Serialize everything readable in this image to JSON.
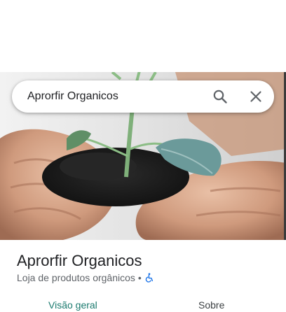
{
  "search": {
    "value": "Aprorfir Organicos",
    "search_icon": "search-icon",
    "close_icon": "close-icon"
  },
  "hero": {
    "image_subject": "hands-holding-soil-seedling-photo"
  },
  "place": {
    "title": "Aprorfir Organicos",
    "category": "Loja de produtos orgânicos",
    "separator": "•",
    "accessibility_icon": "wheelchair-icon"
  },
  "tabs": [
    {
      "label": "Visão geral",
      "active": true
    },
    {
      "label": "Sobre",
      "active": false
    }
  ],
  "colors": {
    "active_tab": "#1a7a6e",
    "accessibility_icon": "#1a73e8",
    "title_text": "#202124",
    "secondary_text": "#5f6368"
  }
}
